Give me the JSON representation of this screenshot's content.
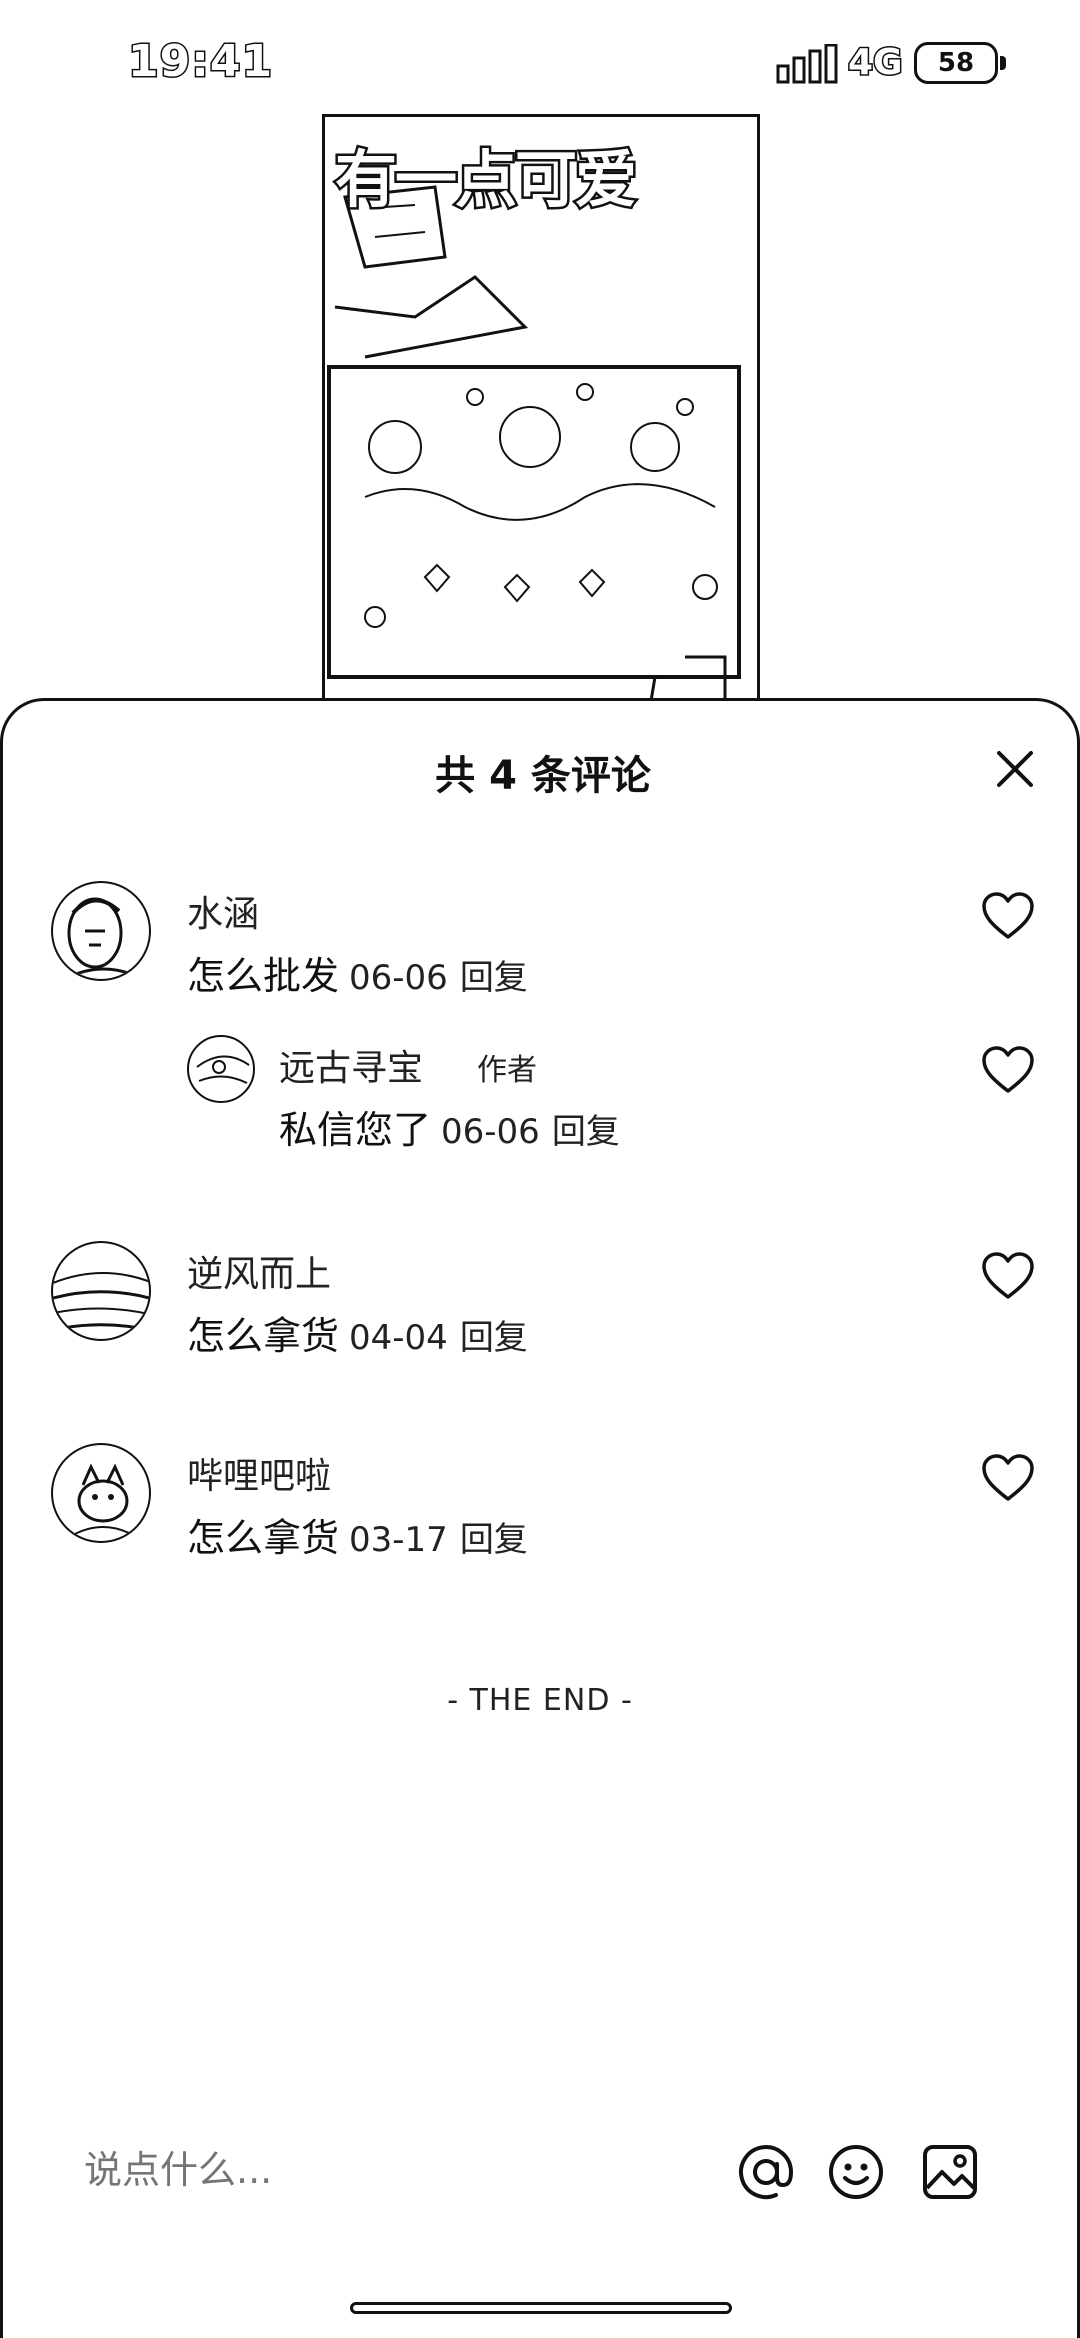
{
  "status_bar": {
    "time": "19:41",
    "network": "4G",
    "battery": "58"
  },
  "video": {
    "caption": "有一点可爱"
  },
  "comments_panel": {
    "title": "共 4 条评论",
    "comments": [
      {
        "username": "水涵",
        "text": "怎么批发",
        "date": "06-06",
        "reply_label": "回复",
        "replies": [
          {
            "username": "远古寻宝",
            "author_tag": "作者",
            "text": "私信您了",
            "date": "06-06",
            "reply_label": "回复"
          }
        ]
      },
      {
        "username": "逆风而上",
        "text": "怎么拿货",
        "date": "04-04",
        "reply_label": "回复"
      },
      {
        "username": "哔哩吧啦",
        "text": "怎么拿货",
        "date": "03-17",
        "reply_label": "回复"
      }
    ],
    "end_label": "- THE END -"
  },
  "input_bar": {
    "placeholder": "说点什么..."
  },
  "icons": {
    "close": "close-icon",
    "like": "heart-icon",
    "mention": "at-icon",
    "emoji": "smiley-icon",
    "image": "image-icon"
  }
}
